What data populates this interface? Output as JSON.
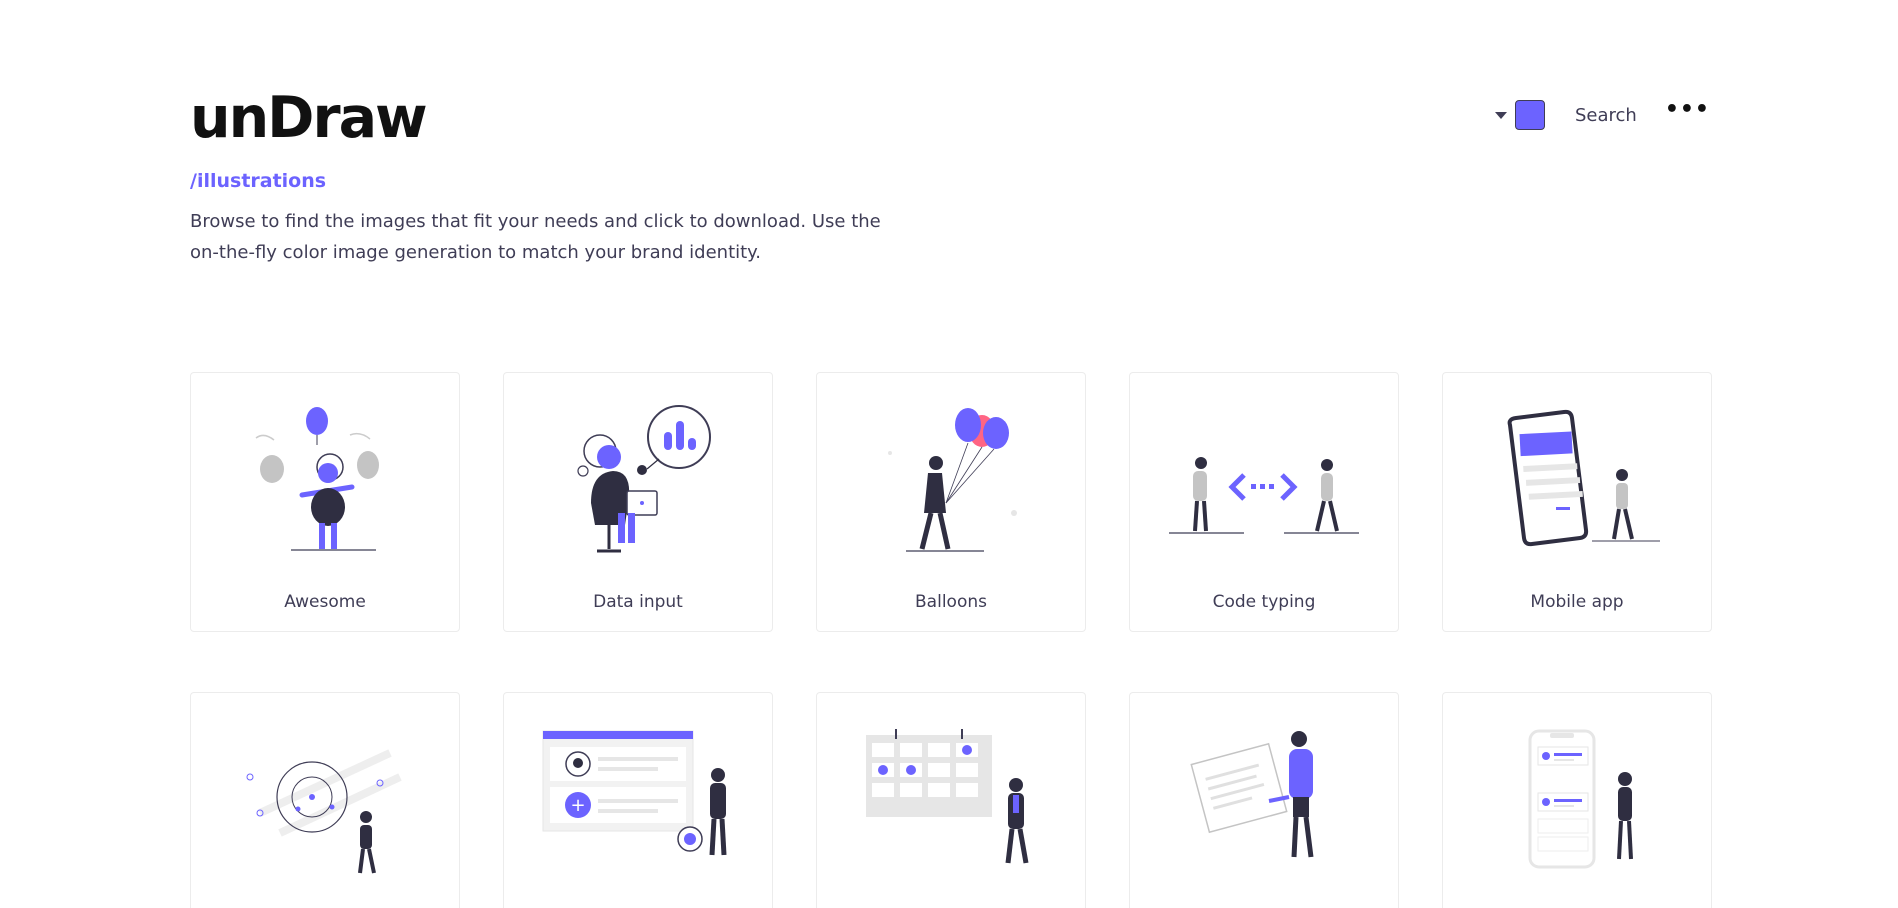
{
  "header": {
    "logo": "unDraw",
    "sublink": "/illustrations",
    "description": "Browse to find the images that fit your needs and click to download. Use the on-the-fly color image generation to match your brand identity."
  },
  "toolbar": {
    "accent_color": "#6c63ff",
    "search_label": "Search",
    "more_label": "•••"
  },
  "cards": [
    {
      "title": "Awesome",
      "icon": "awesome-illustration"
    },
    {
      "title": "Data input",
      "icon": "data-input-illustration"
    },
    {
      "title": "Balloons",
      "icon": "balloons-illustration"
    },
    {
      "title": "Code typing",
      "icon": "code-typing-illustration"
    },
    {
      "title": "Mobile app",
      "icon": "mobile-app-illustration"
    },
    {
      "title": "",
      "icon": "target-illustration"
    },
    {
      "title": "",
      "icon": "profile-list-illustration"
    },
    {
      "title": "",
      "icon": "calendar-illustration"
    },
    {
      "title": "",
      "icon": "document-illustration"
    },
    {
      "title": "",
      "icon": "phone-list-illustration"
    }
  ],
  "colors": {
    "primary": "#6c63ff",
    "dark": "#2f2e41",
    "text": "#3f3d56",
    "light_gray": "#e6e6e6",
    "pink": "#ff6584"
  }
}
